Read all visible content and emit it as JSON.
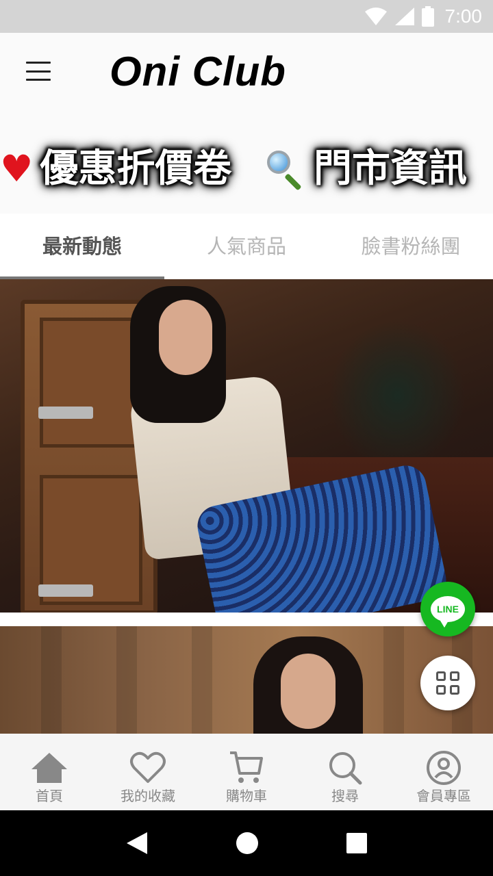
{
  "status_bar": {
    "time": "7:00",
    "icons": [
      "wifi-icon",
      "signal-icon",
      "battery-icon"
    ]
  },
  "header": {
    "menu_icon": "hamburger-menu-icon",
    "logo": "Oni Club"
  },
  "promo": {
    "coupon_label": "優惠折價卷",
    "coupon_icon": "heart-icon",
    "store_label": "門市資訊",
    "store_icon": "magnifier-icon"
  },
  "tabs": [
    {
      "label": "最新動態",
      "active": true
    },
    {
      "label": "人氣商品",
      "active": false
    },
    {
      "label": "臉書粉絲團",
      "active": false
    }
  ],
  "fabs": {
    "line_label": "LINE",
    "grid_icon": "grid-icon"
  },
  "bottom_nav": [
    {
      "label": "首頁",
      "icon": "home-icon"
    },
    {
      "label": "我的收藏",
      "icon": "heart-outline-icon"
    },
    {
      "label": "購物車",
      "icon": "cart-icon"
    },
    {
      "label": "搜尋",
      "icon": "search-icon"
    },
    {
      "label": "會員專區",
      "icon": "user-icon"
    }
  ],
  "colors": {
    "status_bar": "#d4d4d4",
    "heart": "#e0141e",
    "line_green": "#16b821",
    "tab_inactive": "#b5b5b5",
    "tab_active": "#555555",
    "nav_icon": "#888888"
  }
}
